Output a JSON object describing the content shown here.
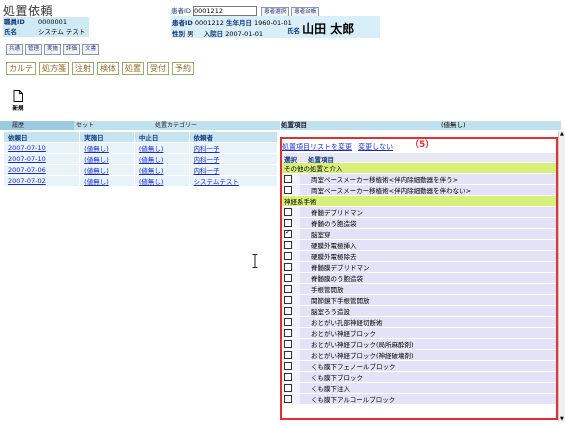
{
  "page": {
    "title": "処置依頼"
  },
  "staff": {
    "id_label": "職員ID",
    "id_value": "0000001",
    "name_label": "氏名",
    "name_value": "システム テスト"
  },
  "category_buttons": [
    "共通",
    "管理",
    "実施",
    "評価",
    "文書"
  ],
  "quick_buttons": [
    "カルテ",
    "処方箋",
    "注射",
    "検体",
    "処置",
    "受付",
    "予約"
  ],
  "patient_search": {
    "label": "患者ID",
    "value": "0001212",
    "select_button": "患者選択",
    "ledger_button": "患者台帳"
  },
  "patient": {
    "id_label": "患者ID",
    "id_value": "0001212",
    "dob_label": "生年月日",
    "dob_value": "1960-01-01",
    "sex_label": "性別",
    "sex_value": "男",
    "admit_label": "入院日",
    "admit_value": "2007-01-01",
    "name_label": "氏名",
    "name_value": "山田 太郎"
  },
  "toolbar": {
    "new_label": "新規"
  },
  "left_tabs": [
    "履歴",
    "セット",
    "処置カテゴリー"
  ],
  "history": {
    "headers": [
      "依頼日",
      "実施日",
      "中止日",
      "依頼者"
    ],
    "rows": [
      {
        "date": "2007-07-10",
        "done": "(値無し)",
        "stop": "(値無し)",
        "by": "内科一子"
      },
      {
        "date": "2007-07-10",
        "done": "(値無し)",
        "stop": "(値無し)",
        "by": "内科一子"
      },
      {
        "date": "2007-07-06",
        "done": "(値無し)",
        "stop": "(値無し)",
        "by": "内科一子"
      },
      {
        "date": "2007-07-02",
        "done": "(値無し)",
        "stop": "(値無し)",
        "by": "システムテスト"
      }
    ]
  },
  "items_panel": {
    "header_label": "処置項目",
    "header_value": "(値無し)",
    "change_list_link": "処置項目リストを変更",
    "no_change_link": "変更しない",
    "annotation": "（5）",
    "col_select": "選択",
    "col_item": "処置項目",
    "groups": [
      {
        "name": "その他の処置と介入",
        "items": [
          {
            "label": "両室ペースメーカー移植術<伴内除細動器を伴う>",
            "checked": false
          },
          {
            "label": "両室ペースメーカー移植術<伴内除細動器を伴わない>",
            "checked": false
          }
        ]
      },
      {
        "name": "神経系手術",
        "items": [
          {
            "label": "脊髄デブリドマン",
            "checked": false
          },
          {
            "label": "脊髄のう胞造袋",
            "checked": false
          },
          {
            "label": "脳室穿",
            "checked": true
          },
          {
            "label": "硬膜外電極挿入",
            "checked": false
          },
          {
            "label": "硬膜外電極除去",
            "checked": false
          },
          {
            "label": "脊髄膜デブリドマン",
            "checked": false
          },
          {
            "label": "脊髄膜のう胞造袋",
            "checked": false
          },
          {
            "label": "手根管開放",
            "checked": false
          },
          {
            "label": "関節鏡下手根管開放",
            "checked": false
          },
          {
            "label": "脳室ろう造設",
            "checked": false
          },
          {
            "label": "おとがい孔部神経切断術",
            "checked": false
          },
          {
            "label": "おとがい神経ブロック",
            "checked": false
          },
          {
            "label": "おとがい神経ブロック(局所麻酔剤)",
            "checked": false
          },
          {
            "label": "おとがい神経ブロック(神経破壊剤)",
            "checked": false
          },
          {
            "label": "くも膜下フェノールブロック",
            "checked": false
          },
          {
            "label": "くも膜下ブロック",
            "checked": false
          },
          {
            "label": "くも膜下注入",
            "checked": false
          },
          {
            "label": "くも膜下アルコールブロック",
            "checked": false
          }
        ]
      }
    ]
  }
}
